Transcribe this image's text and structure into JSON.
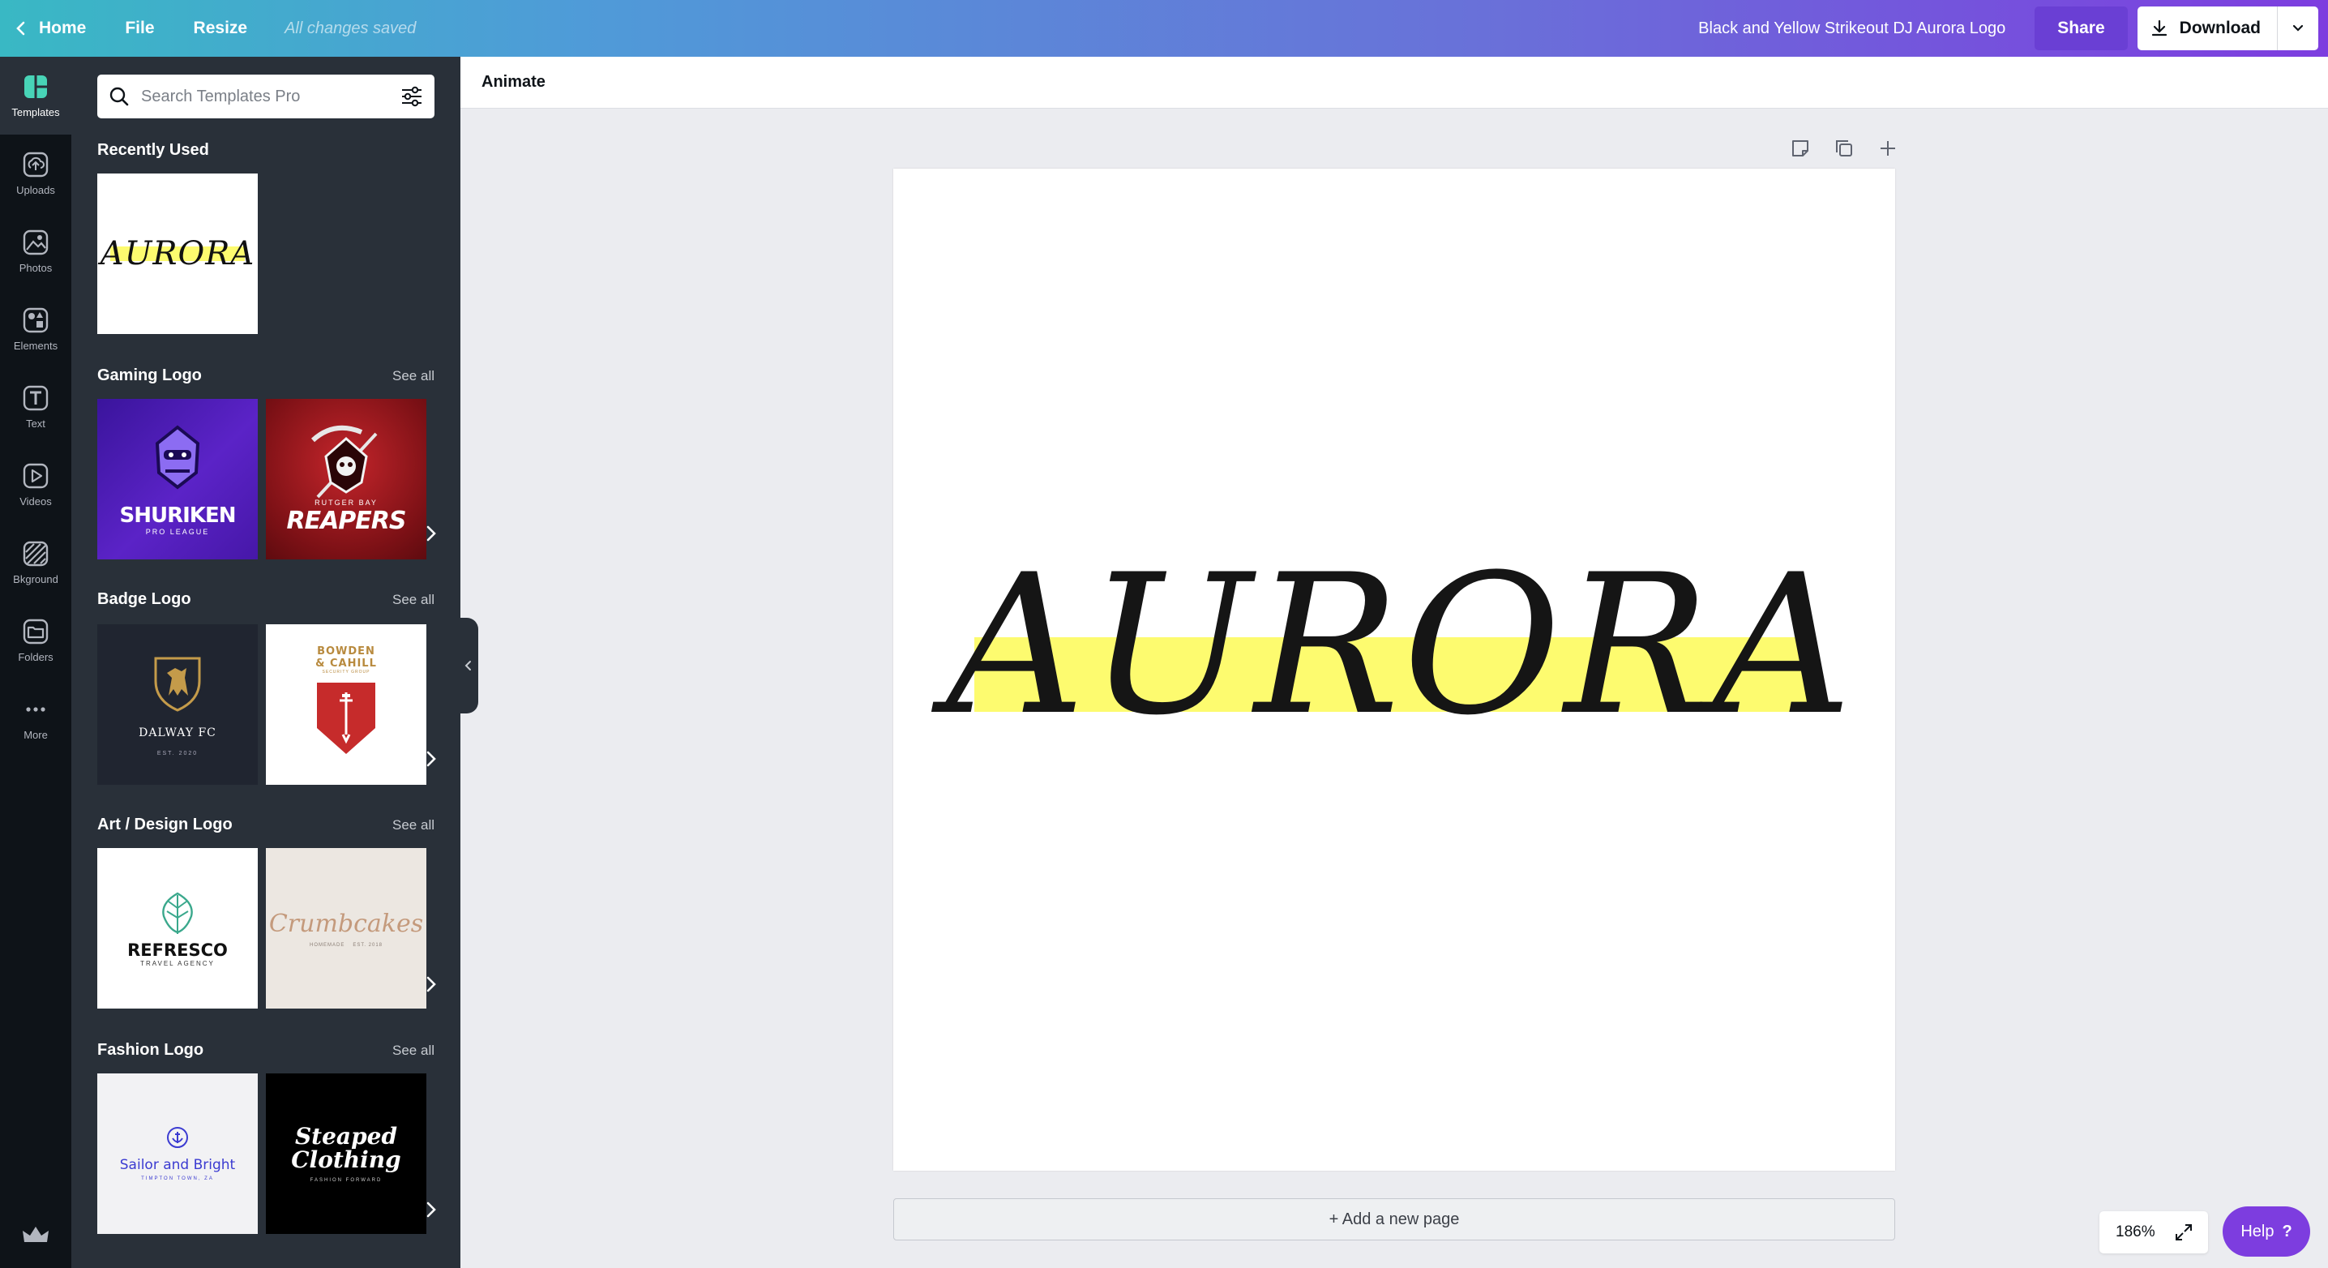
{
  "topbar": {
    "home_label": "Home",
    "file_label": "File",
    "resize_label": "Resize",
    "saved_status": "All changes saved",
    "doc_title": "Black and Yellow Strikeout DJ Aurora Logo",
    "share_label": "Share",
    "download_label": "Download"
  },
  "rail": {
    "items": [
      {
        "label": "Templates",
        "icon": "templates-icon"
      },
      {
        "label": "Uploads",
        "icon": "upload-icon"
      },
      {
        "label": "Photos",
        "icon": "photo-icon"
      },
      {
        "label": "Elements",
        "icon": "elements-icon"
      },
      {
        "label": "Text",
        "icon": "text-icon"
      },
      {
        "label": "Videos",
        "icon": "video-icon"
      },
      {
        "label": "Bkground",
        "icon": "background-icon"
      },
      {
        "label": "Folders",
        "icon": "folder-icon"
      },
      {
        "label": "More",
        "icon": "more-icon"
      }
    ]
  },
  "panel": {
    "search_placeholder": "Search Templates Pro",
    "see_all": "See all",
    "recently_used": {
      "title": "Recently Used",
      "items": [
        {
          "text": "AURORA"
        }
      ]
    },
    "sections": [
      {
        "title": "Gaming Logo",
        "items": [
          {
            "line1": "SHURIKEN",
            "line2": "PRO LEAGUE"
          },
          {
            "line1": "RUTGER BAY",
            "line2": "REAPERS"
          }
        ]
      },
      {
        "title": "Badge Logo",
        "items": [
          {
            "line1": "DALWAY FC",
            "line2": "EST. 2020"
          },
          {
            "line1": "BOWDEN",
            "line2": "& CAHILL",
            "line3": "SECURITY GROUP"
          }
        ]
      },
      {
        "title": "Art / Design Logo",
        "items": [
          {
            "line1": "REFRESCO",
            "line2": "TRAVEL AGENCY"
          },
          {
            "line1": "Crumbcakes",
            "line2": "HOMEMADE",
            "line3": "EST. 2018"
          }
        ]
      },
      {
        "title": "Fashion Logo",
        "items": [
          {
            "line1": "Sailor and Bright",
            "line2": "TIMPTON TOWN, ZA"
          },
          {
            "line1": "Steaped",
            "line2": "Clothing",
            "line3": "FASHION FORWARD"
          }
        ]
      }
    ]
  },
  "context_bar": {
    "animate_label": "Animate"
  },
  "canvas": {
    "text": "AURORA",
    "highlight_color": "#fdfb6f"
  },
  "add_page_label": "+ Add a new page",
  "zoom_level": "186%",
  "help_label": "Help",
  "help_glyph": "?",
  "colors": {
    "accent": "#7d3ddf",
    "panel_bg": "#293039",
    "rail_bg": "#0e1318"
  }
}
